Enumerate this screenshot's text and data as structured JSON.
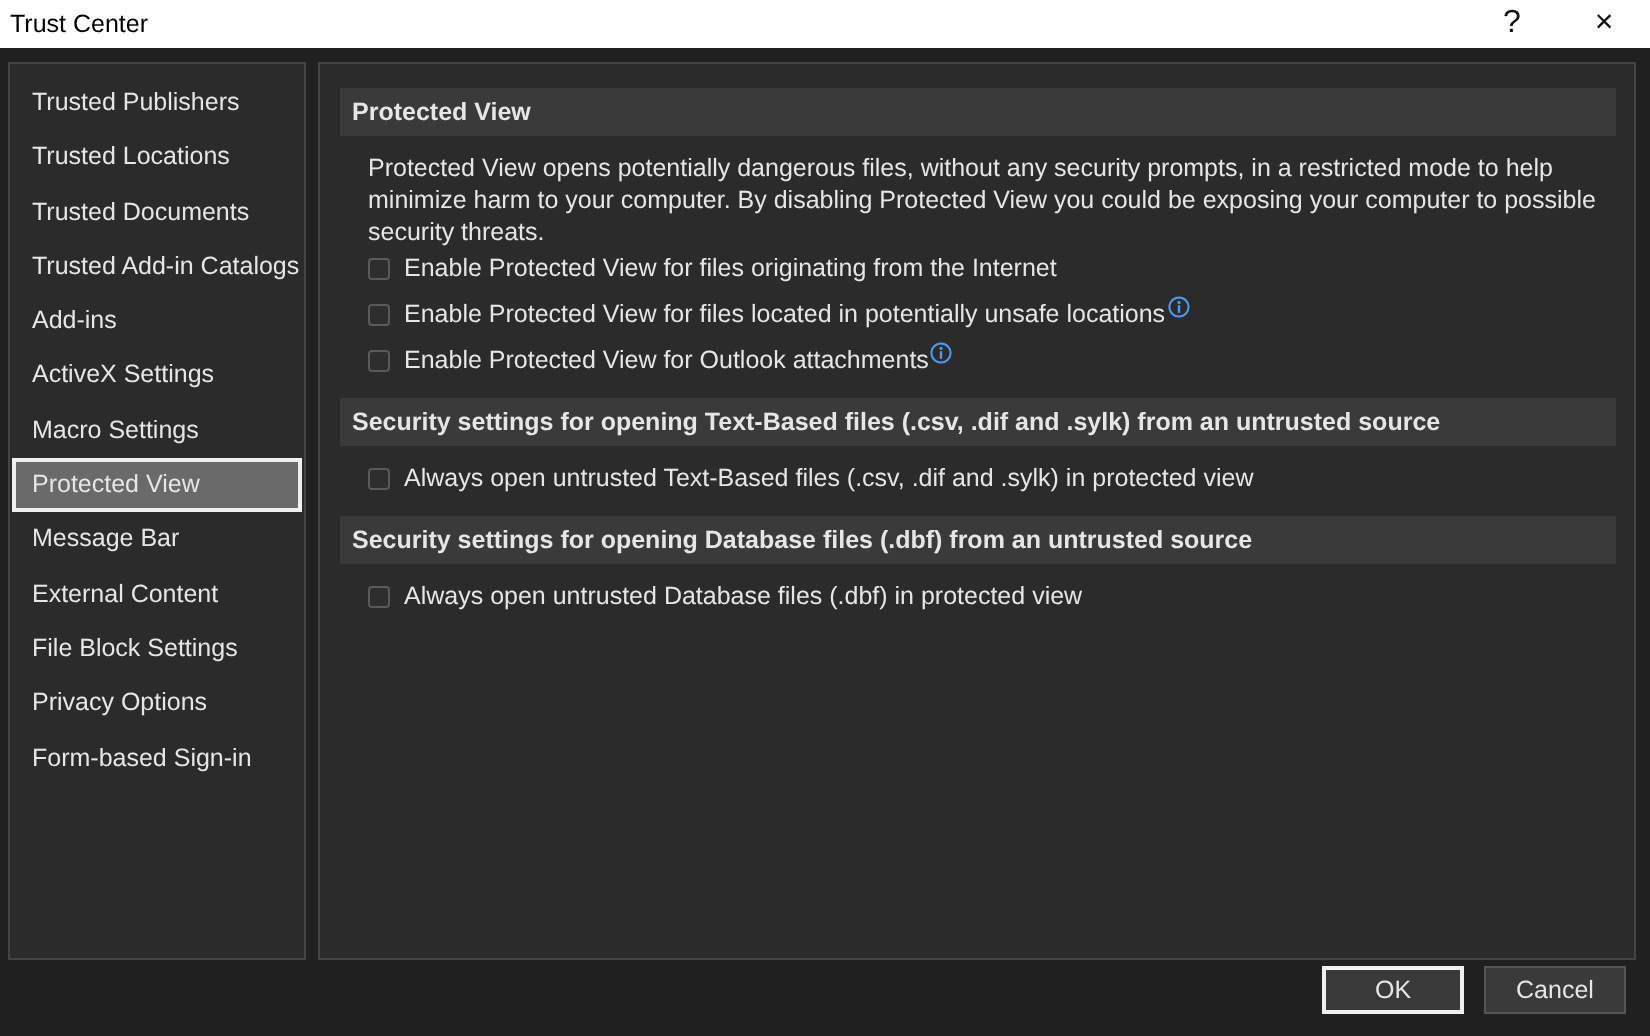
{
  "window": {
    "title": "Trust Center",
    "help": "?",
    "close": "×"
  },
  "sidebar": {
    "items": [
      {
        "label": "Trusted Publishers",
        "selected": false
      },
      {
        "label": "Trusted Locations",
        "selected": false
      },
      {
        "label": "Trusted Documents",
        "selected": false
      },
      {
        "label": "Trusted Add-in Catalogs",
        "selected": false
      },
      {
        "label": "Add-ins",
        "selected": false
      },
      {
        "label": "ActiveX Settings",
        "selected": false
      },
      {
        "label": "Macro Settings",
        "selected": false
      },
      {
        "label": "Protected View",
        "selected": true
      },
      {
        "label": "Message Bar",
        "selected": false
      },
      {
        "label": "External Content",
        "selected": false
      },
      {
        "label": "File Block Settings",
        "selected": false
      },
      {
        "label": "Privacy Options",
        "selected": false
      },
      {
        "label": "Form-based Sign-in",
        "selected": false
      }
    ]
  },
  "sections": [
    {
      "heading": "Protected View",
      "description": "Protected View opens potentially dangerous files, without any security prompts, in a restricted mode to help minimize harm to your computer. By disabling Protected View you could be exposing your computer to possible security threats.",
      "options": [
        {
          "label": "Enable Protected View for files originating from the Internet",
          "checked": false,
          "info": false
        },
        {
          "label": "Enable Protected View for files located in potentially unsafe locations",
          "checked": false,
          "info": true
        },
        {
          "label": "Enable Protected View for Outlook attachments",
          "checked": false,
          "info": true
        }
      ]
    },
    {
      "heading": "Security settings for opening Text-Based files (.csv, .dif and .sylk) from an untrusted source",
      "options": [
        {
          "label": "Always open untrusted Text-Based files (.csv, .dif and .sylk) in protected view",
          "checked": false,
          "info": false
        }
      ]
    },
    {
      "heading": "Security settings for opening Database files (.dbf) from an untrusted source",
      "options": [
        {
          "label": "Always open untrusted Database files (.dbf) in protected view",
          "checked": false,
          "info": false
        }
      ]
    }
  ],
  "buttons": [
    {
      "label": "OK",
      "default": true
    },
    {
      "label": "Cancel",
      "default": false
    }
  ]
}
